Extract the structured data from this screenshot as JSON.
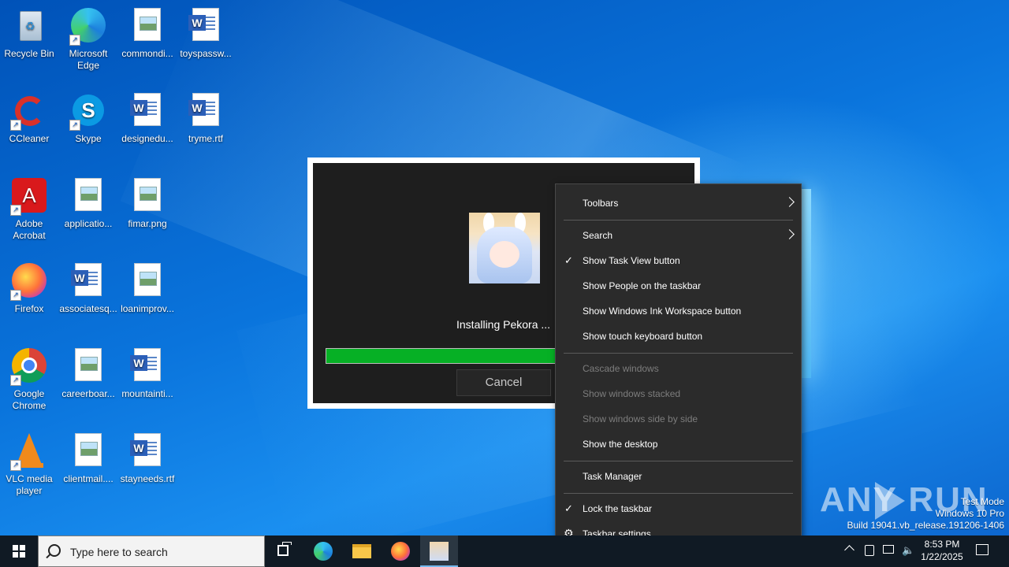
{
  "desktop": {
    "icons": [
      {
        "label": "Recycle Bin"
      },
      {
        "label": "Microsoft Edge"
      },
      {
        "label": "commondi..."
      },
      {
        "label": "toyspassw..."
      },
      {
        "label": "CCleaner"
      },
      {
        "label": "Skype"
      },
      {
        "label": "designedu..."
      },
      {
        "label": "tryme.rtf"
      },
      {
        "label": "Adobe Acrobat"
      },
      {
        "label": "applicatio..."
      },
      {
        "label": "fimar.png"
      },
      {
        "label": "Firefox"
      },
      {
        "label": "associatesq..."
      },
      {
        "label": "loanimprov..."
      },
      {
        "label": "Google Chrome"
      },
      {
        "label": "careerboar..."
      },
      {
        "label": "mountainti..."
      },
      {
        "label": "VLC media player"
      },
      {
        "label": "clientmail...."
      },
      {
        "label": "stayneeds.rtf"
      }
    ]
  },
  "installer": {
    "status_text": "Installing Pekora ...",
    "progress_fraction": 0.65,
    "cancel_label": "Cancel",
    "progress_color": "#06b025"
  },
  "context_menu": {
    "items": [
      {
        "label": "Toolbars",
        "submenu": true
      },
      {
        "label": "Search",
        "submenu": true
      },
      {
        "label": "Show Task View button",
        "checked": true
      },
      {
        "label": "Show People on the taskbar"
      },
      {
        "label": "Show Windows Ink Workspace button"
      },
      {
        "label": "Show touch keyboard button"
      },
      {
        "label": "Cascade windows",
        "disabled": true
      },
      {
        "label": "Show windows stacked",
        "disabled": true
      },
      {
        "label": "Show windows side by side",
        "disabled": true
      },
      {
        "label": "Show the desktop"
      },
      {
        "label": "Task Manager"
      },
      {
        "label": "Lock the taskbar",
        "checked": true
      },
      {
        "label": "Taskbar settings",
        "icon": "gear-icon"
      }
    ]
  },
  "watermark": {
    "text": "ANY RUN",
    "test_mode": "Test Mode",
    "edition": "Windows 10 Pro",
    "build": "Build 19041.vb_release.191206-1406"
  },
  "taskbar": {
    "search_placeholder": "Type here to search",
    "apps": [
      {
        "icon": "task-view-icon"
      },
      {
        "icon": "edge-icon"
      },
      {
        "icon": "file-explorer-icon"
      },
      {
        "icon": "firefox-icon"
      },
      {
        "icon": "pekora-installer-icon",
        "active": true
      }
    ],
    "clock_time": "8:53 PM",
    "clock_date": "1/22/2025"
  }
}
